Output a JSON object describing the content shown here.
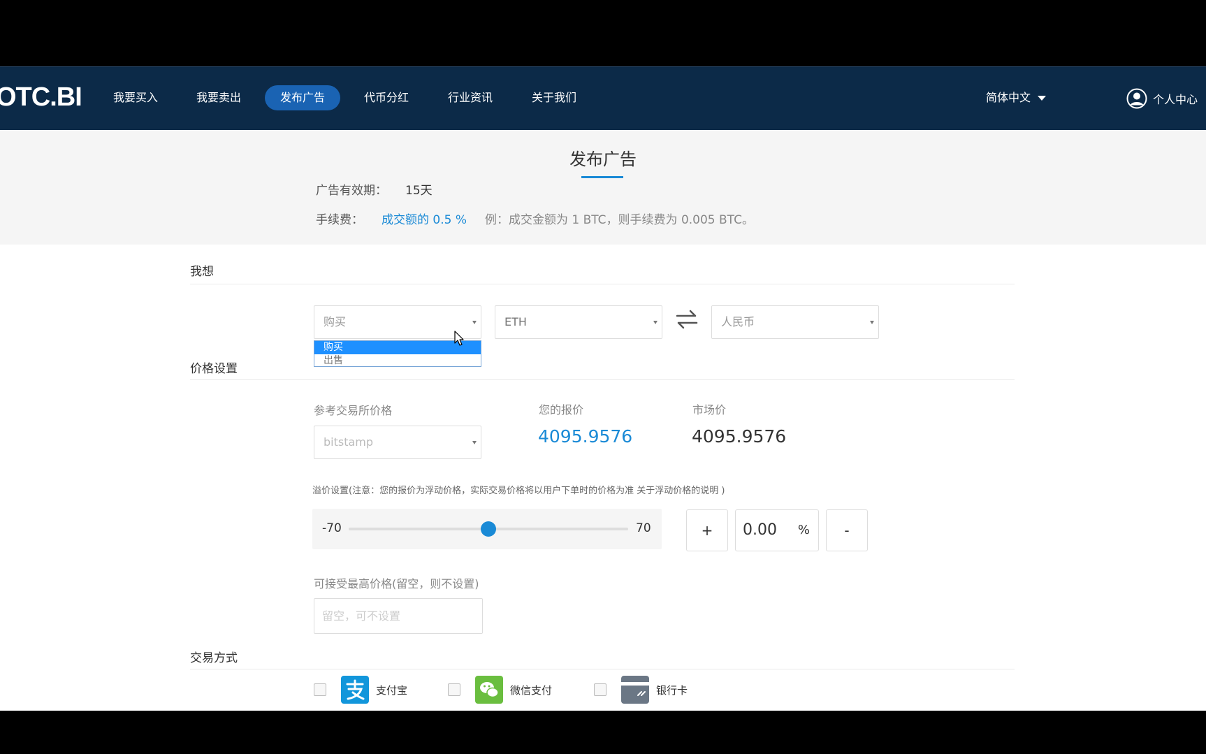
{
  "header": {
    "logo": "OTC.BI",
    "nav": [
      {
        "label": "我要买入"
      },
      {
        "label": "我要卖出"
      },
      {
        "label": "发布广告",
        "active": true
      },
      {
        "label": "代币分红"
      },
      {
        "label": "行业资讯"
      },
      {
        "label": "关于我们"
      }
    ],
    "language": "简体中文",
    "user_center": "个人中心"
  },
  "info": {
    "page_title": "发布广告",
    "validity_label": "广告有效期：",
    "validity_value": "15天",
    "fee_label": "手续费：",
    "fee_link": "成交额的 0.5 %",
    "fee_note": "例：成交金额为 1 BTC，则手续费为 0.005 BTC。"
  },
  "intent": {
    "section_title": "我想",
    "action_select": "购买",
    "action_options": [
      "购买",
      "出售"
    ],
    "coin_select": "ETH",
    "currency_select": "人民币"
  },
  "pricing": {
    "section_title": "价格设置",
    "ref_exchange_label": "参考交易所价格",
    "ref_exchange_value": "bitstamp",
    "your_price_label": "您的报价",
    "your_price_value": "4095.9576",
    "market_price_label": "市场价",
    "market_price_value": "4095.9576",
    "premium_note": "溢价设置(注意：您的报价为浮动价格，实际交易价格将以用户下单时的价格为准 关于浮动价格的说明 )",
    "slider_min": "-70",
    "slider_max": "70",
    "slider_value": 0,
    "plus": "+",
    "minus": "-",
    "premium_value": "0.00",
    "percent": "%",
    "max_price_label": "可接受最高价格(留空，则不设置)",
    "max_price_placeholder": "留空，可不设置"
  },
  "payment": {
    "section_title": "交易方式",
    "methods": [
      {
        "label": "支付宝",
        "color": "#1296db"
      },
      {
        "label": "微信支付",
        "color": "#6abe3f"
      },
      {
        "label": "银行卡",
        "color": "#6b7785"
      }
    ]
  },
  "colors": {
    "nav_bg": "#0c2a48",
    "accent": "#1a8ad6",
    "active_nav": "#1a63b3"
  }
}
